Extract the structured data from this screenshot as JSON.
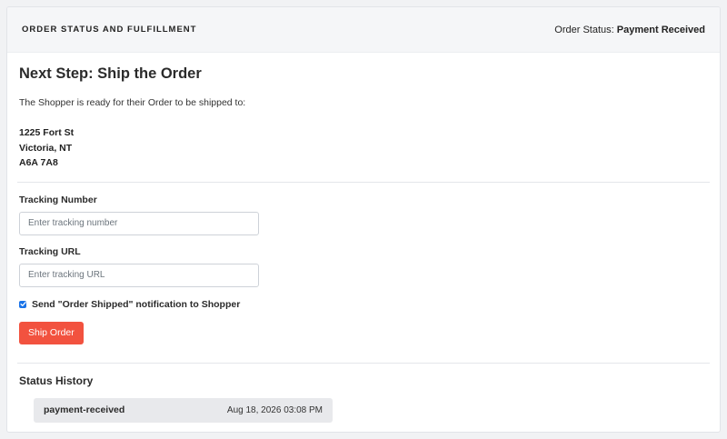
{
  "header": {
    "title": "ORDER STATUS AND FULFILLMENT",
    "status_label": "Order Status:",
    "status_value": "Payment Received"
  },
  "step": {
    "title": "Next Step: Ship the Order",
    "intro": "The Shopper is ready for their Order to be shipped to:"
  },
  "address": {
    "line1": "1225 Fort St",
    "line2": "Victoria, NT",
    "line3": "A6A 7A8"
  },
  "form": {
    "tracking_number_label": "Tracking Number",
    "tracking_number_placeholder": "Enter tracking number",
    "tracking_number_value": "",
    "tracking_url_label": "Tracking URL",
    "tracking_url_placeholder": "Enter tracking URL",
    "tracking_url_value": "",
    "notify_label": "Send \"Order Shipped\" notification to Shopper",
    "notify_checked": true,
    "submit_label": "Ship Order"
  },
  "history": {
    "title": "Status History",
    "items": [
      {
        "status": "payment-received",
        "time": "Aug 18, 2026 03:08 PM"
      }
    ]
  },
  "colors": {
    "accent_button": "#f2523f",
    "checkbox": "#1a73e8",
    "header_bg": "#f5f6f8",
    "history_row_bg": "#e8e9ec"
  }
}
